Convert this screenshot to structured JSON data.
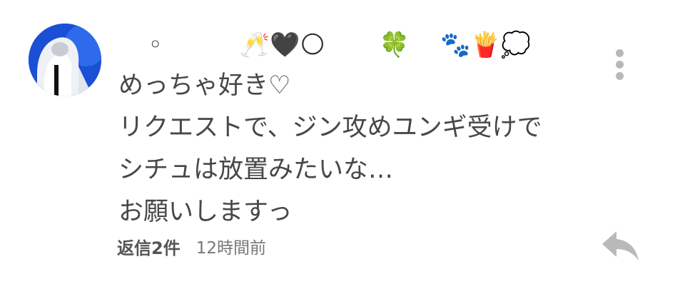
{
  "comment": {
    "avatar_icon": "user-avatar-icon",
    "username": "  ◦          🥂🖤🌕       🍀    🐾🍟💭",
    "body_lines": [
      "めっちゃ好き♡",
      "リクエストで、ジン攻めユンギ受けで",
      "シチュは放置みたいな…",
      "お願いしますっ"
    ],
    "replies_label": "返信2件",
    "timestamp": "12時間前",
    "more_icon": "more-vertical-icon",
    "reply_icon": "reply-arrow-icon"
  }
}
